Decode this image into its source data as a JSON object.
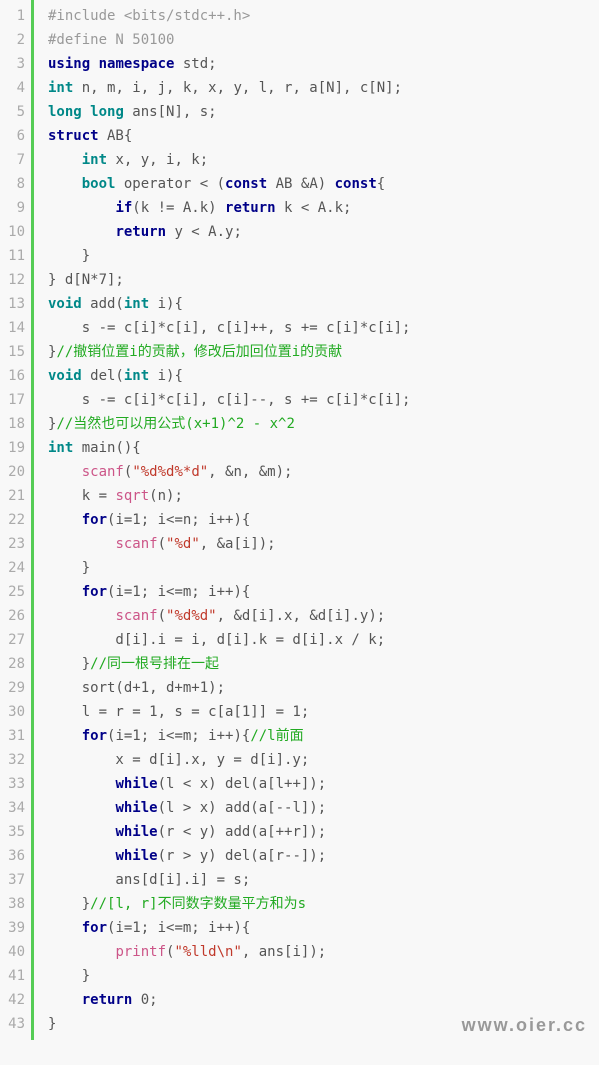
{
  "watermark": "www.oier.cc",
  "lines": [
    {
      "n": "1",
      "tokens": [
        {
          "c": "pp",
          "t": "#include <bits/stdc++.h>"
        }
      ]
    },
    {
      "n": "2",
      "tokens": [
        {
          "c": "pp",
          "t": "#define N 50100"
        }
      ]
    },
    {
      "n": "3",
      "tokens": [
        {
          "c": "kw",
          "t": "using"
        },
        {
          "c": "fn",
          "t": " "
        },
        {
          "c": "kw",
          "t": "namespace"
        },
        {
          "c": "fn",
          "t": " std;"
        }
      ]
    },
    {
      "n": "4",
      "tokens": [
        {
          "c": "ty",
          "t": "int"
        },
        {
          "c": "fn",
          "t": " n, m, i, j, k, x, y, l, r, a[N], c[N];"
        }
      ]
    },
    {
      "n": "5",
      "tokens": [
        {
          "c": "ty",
          "t": "long"
        },
        {
          "c": "fn",
          "t": " "
        },
        {
          "c": "ty",
          "t": "long"
        },
        {
          "c": "fn",
          "t": " ans[N], s;"
        }
      ]
    },
    {
      "n": "6",
      "tokens": [
        {
          "c": "kw",
          "t": "struct"
        },
        {
          "c": "fn",
          "t": " AB{"
        }
      ]
    },
    {
      "n": "7",
      "tokens": [
        {
          "c": "fn",
          "t": "    "
        },
        {
          "c": "ty",
          "t": "int"
        },
        {
          "c": "fn",
          "t": " x, y, i, k;"
        }
      ]
    },
    {
      "n": "8",
      "tokens": [
        {
          "c": "fn",
          "t": "    "
        },
        {
          "c": "ty",
          "t": "bool"
        },
        {
          "c": "fn",
          "t": " operator < ("
        },
        {
          "c": "kw",
          "t": "const"
        },
        {
          "c": "fn",
          "t": " AB &A) "
        },
        {
          "c": "kw",
          "t": "const"
        },
        {
          "c": "fn",
          "t": "{"
        }
      ]
    },
    {
      "n": "9",
      "tokens": [
        {
          "c": "fn",
          "t": "        "
        },
        {
          "c": "kw",
          "t": "if"
        },
        {
          "c": "fn",
          "t": "(k != A.k) "
        },
        {
          "c": "kw",
          "t": "return"
        },
        {
          "c": "fn",
          "t": " k < A.k;"
        }
      ]
    },
    {
      "n": "10",
      "tokens": [
        {
          "c": "fn",
          "t": "        "
        },
        {
          "c": "kw",
          "t": "return"
        },
        {
          "c": "fn",
          "t": " y < A.y;"
        }
      ]
    },
    {
      "n": "11",
      "tokens": [
        {
          "c": "fn",
          "t": "    }"
        }
      ]
    },
    {
      "n": "12",
      "tokens": [
        {
          "c": "fn",
          "t": "} d[N*7];"
        }
      ]
    },
    {
      "n": "13",
      "tokens": [
        {
          "c": "ty",
          "t": "void"
        },
        {
          "c": "fn",
          "t": " add("
        },
        {
          "c": "ty",
          "t": "int"
        },
        {
          "c": "fn",
          "t": " i){"
        }
      ]
    },
    {
      "n": "14",
      "tokens": [
        {
          "c": "fn",
          "t": "    s -= c[i]*c[i], c[i]++, s += c[i]*c[i];"
        }
      ]
    },
    {
      "n": "15",
      "tokens": [
        {
          "c": "fn",
          "t": "}"
        },
        {
          "c": "cm",
          "t": "//撤销位置i的贡献，修改后加回位置i的贡献"
        }
      ]
    },
    {
      "n": "16",
      "tokens": [
        {
          "c": "ty",
          "t": "void"
        },
        {
          "c": "fn",
          "t": " del("
        },
        {
          "c": "ty",
          "t": "int"
        },
        {
          "c": "fn",
          "t": " i){"
        }
      ]
    },
    {
      "n": "17",
      "tokens": [
        {
          "c": "fn",
          "t": "    s -= c[i]*c[i], c[i]--, s += c[i]*c[i];"
        }
      ]
    },
    {
      "n": "18",
      "tokens": [
        {
          "c": "fn",
          "t": "}"
        },
        {
          "c": "cm",
          "t": "//当然也可以用公式(x+1)^2 - x^2"
        }
      ]
    },
    {
      "n": "19",
      "tokens": [
        {
          "c": "ty",
          "t": "int"
        },
        {
          "c": "fn",
          "t": " main(){"
        }
      ]
    },
    {
      "n": "20",
      "tokens": [
        {
          "c": "fn",
          "t": "    "
        },
        {
          "c": "bi",
          "t": "scanf"
        },
        {
          "c": "fn",
          "t": "("
        },
        {
          "c": "str",
          "t": "\"%d%d%*d\""
        },
        {
          "c": "fn",
          "t": ", &n, &m);"
        }
      ]
    },
    {
      "n": "21",
      "tokens": [
        {
          "c": "fn",
          "t": "    k = "
        },
        {
          "c": "bi",
          "t": "sqrt"
        },
        {
          "c": "fn",
          "t": "(n);"
        }
      ]
    },
    {
      "n": "22",
      "tokens": [
        {
          "c": "fn",
          "t": "    "
        },
        {
          "c": "kw",
          "t": "for"
        },
        {
          "c": "fn",
          "t": "(i=1; i<=n; i++){"
        }
      ]
    },
    {
      "n": "23",
      "tokens": [
        {
          "c": "fn",
          "t": "        "
        },
        {
          "c": "bi",
          "t": "scanf"
        },
        {
          "c": "fn",
          "t": "("
        },
        {
          "c": "str",
          "t": "\"%d\""
        },
        {
          "c": "fn",
          "t": ", &a[i]);"
        }
      ]
    },
    {
      "n": "24",
      "tokens": [
        {
          "c": "fn",
          "t": "    }"
        }
      ]
    },
    {
      "n": "25",
      "tokens": [
        {
          "c": "fn",
          "t": "    "
        },
        {
          "c": "kw",
          "t": "for"
        },
        {
          "c": "fn",
          "t": "(i=1; i<=m; i++){"
        }
      ]
    },
    {
      "n": "26",
      "tokens": [
        {
          "c": "fn",
          "t": "        "
        },
        {
          "c": "bi",
          "t": "scanf"
        },
        {
          "c": "fn",
          "t": "("
        },
        {
          "c": "str",
          "t": "\"%d%d\""
        },
        {
          "c": "fn",
          "t": ", &d[i].x, &d[i].y);"
        }
      ]
    },
    {
      "n": "27",
      "tokens": [
        {
          "c": "fn",
          "t": "        d[i].i = i, d[i].k = d[i].x / k;"
        }
      ]
    },
    {
      "n": "28",
      "tokens": [
        {
          "c": "fn",
          "t": "    }"
        },
        {
          "c": "cm",
          "t": "//同一根号排在一起"
        }
      ]
    },
    {
      "n": "29",
      "tokens": [
        {
          "c": "fn",
          "t": "    sort(d+1, d+m+1);"
        }
      ]
    },
    {
      "n": "30",
      "tokens": [
        {
          "c": "fn",
          "t": "    l = r = 1, s = c[a[1]] = 1;"
        }
      ]
    },
    {
      "n": "31",
      "tokens": [
        {
          "c": "fn",
          "t": "    "
        },
        {
          "c": "kw",
          "t": "for"
        },
        {
          "c": "fn",
          "t": "(i=1; i<=m; i++){"
        },
        {
          "c": "cm",
          "t": "//l前面"
        }
      ]
    },
    {
      "n": "32",
      "tokens": [
        {
          "c": "fn",
          "t": "        x = d[i].x, y = d[i].y;"
        }
      ]
    },
    {
      "n": "33",
      "tokens": [
        {
          "c": "fn",
          "t": "        "
        },
        {
          "c": "kw",
          "t": "while"
        },
        {
          "c": "fn",
          "t": "(l < x) del(a[l++]);"
        }
      ]
    },
    {
      "n": "34",
      "tokens": [
        {
          "c": "fn",
          "t": "        "
        },
        {
          "c": "kw",
          "t": "while"
        },
        {
          "c": "fn",
          "t": "(l > x) add(a[--l]);"
        }
      ]
    },
    {
      "n": "35",
      "tokens": [
        {
          "c": "fn",
          "t": "        "
        },
        {
          "c": "kw",
          "t": "while"
        },
        {
          "c": "fn",
          "t": "(r < y) add(a[++r]);"
        }
      ]
    },
    {
      "n": "36",
      "tokens": [
        {
          "c": "fn",
          "t": "        "
        },
        {
          "c": "kw",
          "t": "while"
        },
        {
          "c": "fn",
          "t": "(r > y) del(a[r--]);"
        }
      ]
    },
    {
      "n": "37",
      "tokens": [
        {
          "c": "fn",
          "t": "        ans[d[i].i] = s;"
        }
      ]
    },
    {
      "n": "38",
      "tokens": [
        {
          "c": "fn",
          "t": "    }"
        },
        {
          "c": "cm",
          "t": "//[l, r]不同数字数量平方和为s"
        }
      ]
    },
    {
      "n": "39",
      "tokens": [
        {
          "c": "fn",
          "t": "    "
        },
        {
          "c": "kw",
          "t": "for"
        },
        {
          "c": "fn",
          "t": "(i=1; i<=m; i++){"
        }
      ]
    },
    {
      "n": "40",
      "tokens": [
        {
          "c": "fn",
          "t": "        "
        },
        {
          "c": "bi",
          "t": "printf"
        },
        {
          "c": "fn",
          "t": "("
        },
        {
          "c": "str",
          "t": "\"%lld\\n\""
        },
        {
          "c": "fn",
          "t": ", ans[i]);"
        }
      ]
    },
    {
      "n": "41",
      "tokens": [
        {
          "c": "fn",
          "t": "    }"
        }
      ]
    },
    {
      "n": "42",
      "tokens": [
        {
          "c": "fn",
          "t": "    "
        },
        {
          "c": "kw",
          "t": "return"
        },
        {
          "c": "fn",
          "t": " 0;"
        }
      ]
    },
    {
      "n": "43",
      "tokens": [
        {
          "c": "fn",
          "t": "}"
        }
      ]
    }
  ]
}
